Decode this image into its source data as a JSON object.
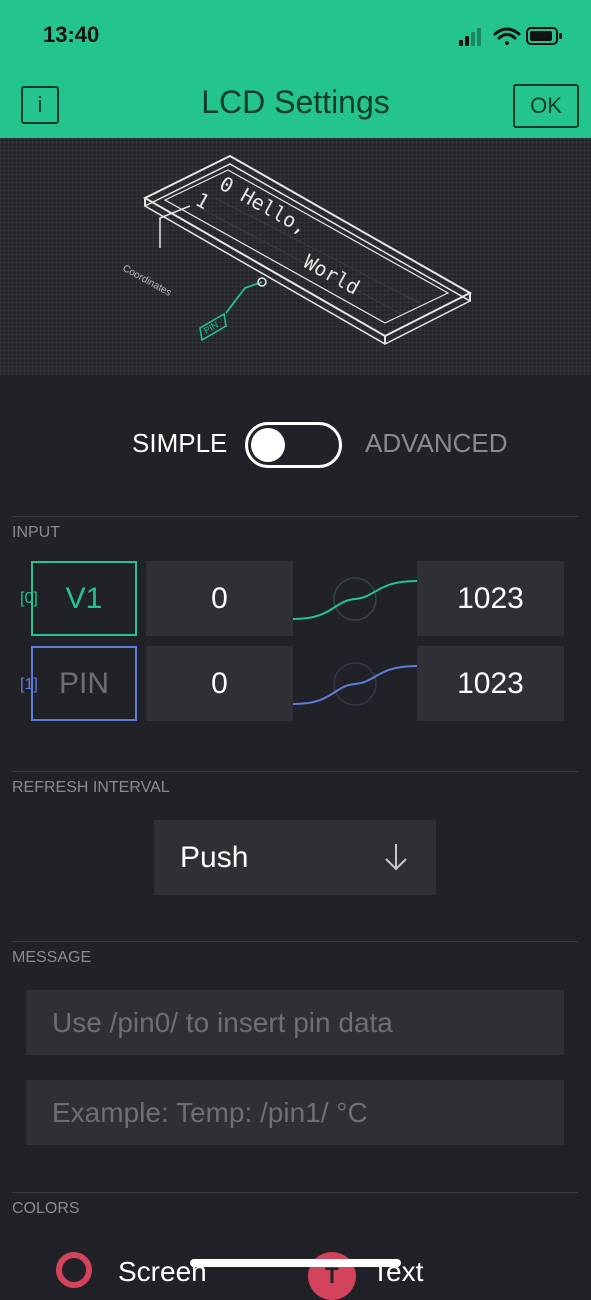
{
  "status_bar": {
    "time": "13:40"
  },
  "header": {
    "title": "LCD Settings",
    "info_label": "i",
    "ok_label": "OK"
  },
  "illustration": {
    "line1": "0 Hello,",
    "line2": "World",
    "row_index": "1",
    "coordinates_label": "Coordinates",
    "pin_label": "PIN"
  },
  "mode": {
    "simple_label": "SIMPLE",
    "advanced_label": "ADVANCED",
    "advanced_enabled": false
  },
  "input": {
    "section_label": "INPUT",
    "rows": [
      {
        "index": "[0]",
        "pin": "V1",
        "min": "0",
        "max": "1023",
        "color": "#23c48e"
      },
      {
        "index": "[1]",
        "pin": "PIN",
        "min": "0",
        "max": "1023",
        "color": "#5f7cd8"
      }
    ]
  },
  "refresh": {
    "section_label": "REFRESH INTERVAL",
    "value": "Push"
  },
  "message": {
    "section_label": "MESSAGE",
    "placeholder1": "Use /pin0/ to insert pin data",
    "placeholder2": "Example: Temp: /pin1/ °C"
  },
  "colors": {
    "section_label": "COLORS",
    "screen_label": "Screen",
    "text_label": "Text",
    "text_icon": "T"
  }
}
